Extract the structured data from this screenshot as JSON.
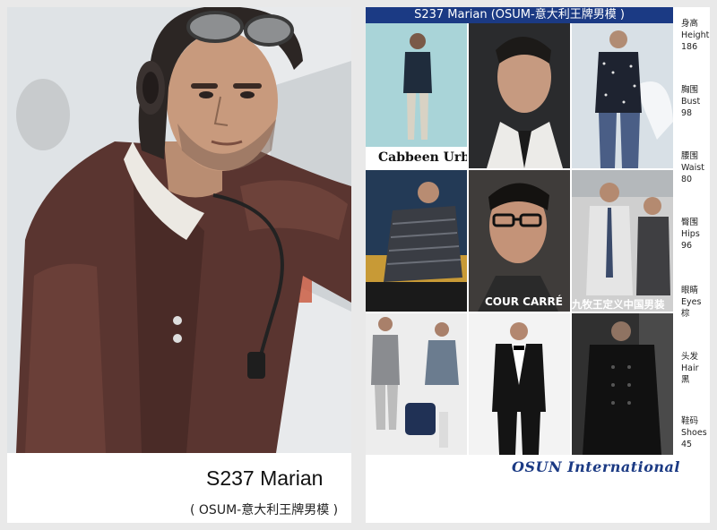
{
  "left_card": {
    "name": "S237 Marian",
    "subtitle": "( OSUM-意大利王牌男模 )"
  },
  "right_card": {
    "banner": "S237  Marian    (OSUM-意大利王牌男模 )",
    "brand_captions": {
      "cabbeen": "Cabbeen Urban",
      "cour": "COUR CARRÉ",
      "jiumu": "九牧王定义中国男装"
    },
    "agency": "OSUN International",
    "stats": [
      {
        "cn": "身高",
        "en": "Height",
        "value": "186"
      },
      {
        "cn": "胸围",
        "en": "Bust",
        "value": "98"
      },
      {
        "cn": "腰围",
        "en": "Waist",
        "value": "80"
      },
      {
        "cn": "臀围",
        "en": "Hips",
        "value": "96"
      },
      {
        "cn": "眼睛",
        "en": "Eyes",
        "value": "棕"
      },
      {
        "cn": "头发",
        "en": "Hair",
        "value": "黑"
      },
      {
        "cn": "鞋码",
        "en": "Shoes",
        "value": "45"
      }
    ]
  },
  "colors": {
    "banner_bg": "#1b3a84",
    "agency_text": "#1b3a84",
    "jacket": "#5a3530",
    "helmet": "#2c2624"
  }
}
